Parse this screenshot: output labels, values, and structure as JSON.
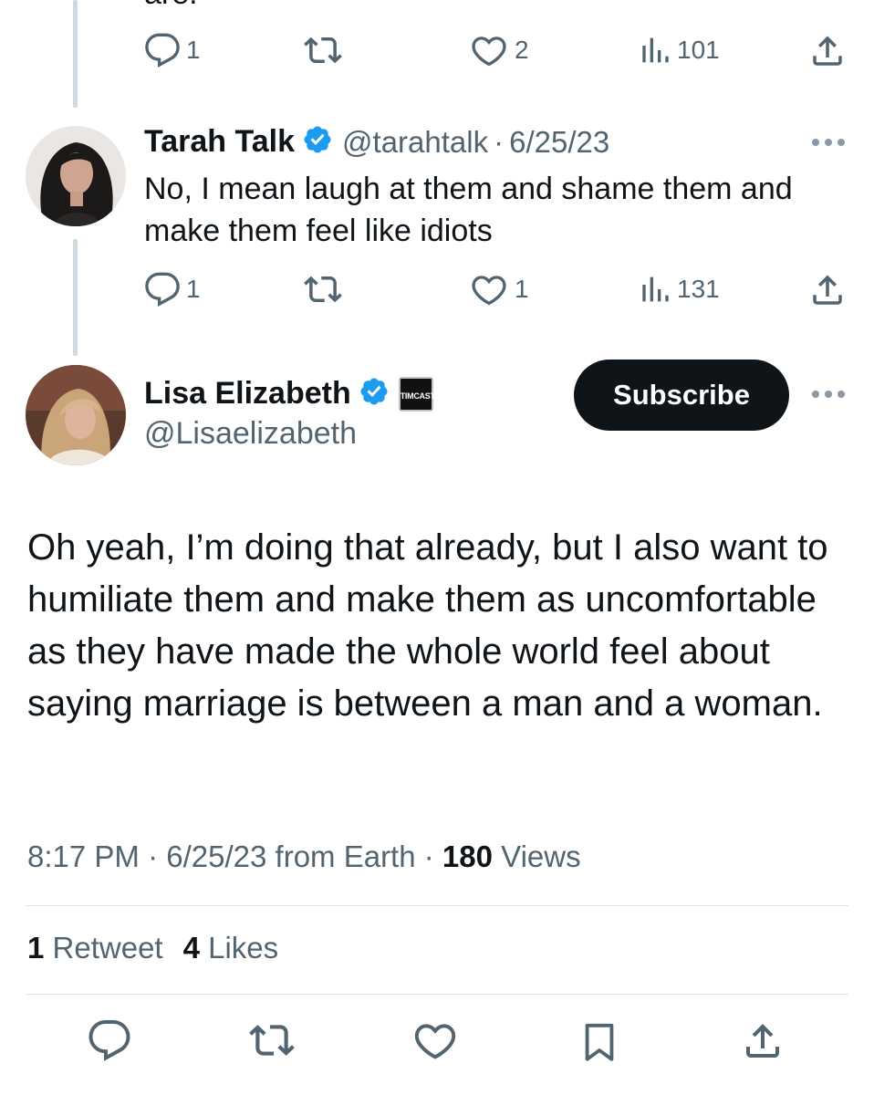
{
  "top_tweet": {
    "partial_text": "are.",
    "actions": {
      "reply_count": "1",
      "retweet_count": "",
      "like_count": "2",
      "view_count": "101"
    }
  },
  "reply_tweet": {
    "name": "Tarah Talk",
    "handle": "@tarahtalk",
    "separator": "·",
    "date": "6/25/23",
    "text": "No, I mean laugh at them and shame them and make them feel like idiots",
    "actions": {
      "reply_count": "1",
      "retweet_count": "",
      "like_count": "1",
      "view_count": "131"
    }
  },
  "main_tweet": {
    "name": "Lisa Elizabeth",
    "affiliate_badge": "TIMCAST",
    "handle": "@Lisaelizabeth",
    "subscribe_label": "Subscribe",
    "text": "Oh yeah, I’m doing that already, but I also want to humiliate them and make them as uncomfortable as they have made the whole world feel about saying marriage is between a man and a woman.",
    "meta": {
      "time": "8:17 PM",
      "separator": "·",
      "date": "6/25/23",
      "source": "from Earth",
      "views_count": "180",
      "views_label": "Views"
    },
    "stats": {
      "retweets_count": "1",
      "retweets_label": "Retweet",
      "likes_count": "4",
      "likes_label": "Likes"
    }
  },
  "colors": {
    "text_primary": "#0f1419",
    "text_secondary": "#536471",
    "verified_blue": "#1d9bf0",
    "divider": "#dfe3e6",
    "thread_line": "#cfd9de"
  },
  "icons": [
    "reply-icon",
    "retweet-icon",
    "like-icon",
    "views-icon",
    "share-icon",
    "verified-icon",
    "more-icon",
    "bookmark-icon"
  ]
}
